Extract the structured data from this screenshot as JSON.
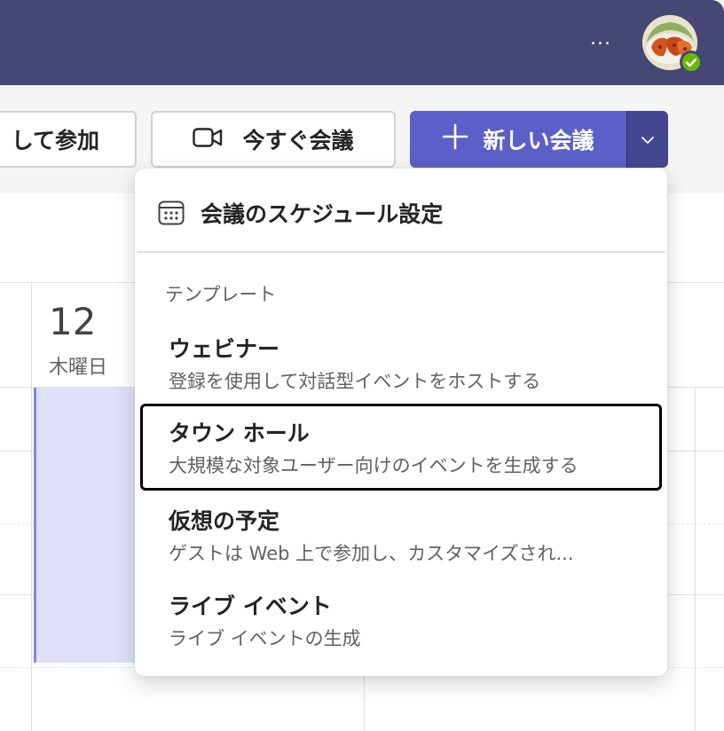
{
  "header": {
    "more_label": "...",
    "avatar_name": "user-avatar"
  },
  "toolbar": {
    "join_label": "して参加",
    "meet_now_label": "今すぐ会議",
    "new_meeting_label": "新しい会議"
  },
  "calendar": {
    "day_number": "12",
    "day_name": "木曜日"
  },
  "menu": {
    "schedule_label": "会議のスケジュール設定",
    "section_label": "テンプレート",
    "items": [
      {
        "title": "ウェビナー",
        "desc": "登録を使用して対話型イベントをホストする"
      },
      {
        "title": "タウン ホール",
        "desc": "大規模な対象ユーザー向けのイベントを生成する"
      },
      {
        "title": "仮想の予定",
        "desc": "ゲストは Web 上で参加し、カスタマイズされ..."
      },
      {
        "title": "ライブ イベント",
        "desc": "ライブ イベントの生成"
      }
    ]
  },
  "colors": {
    "titlebar": "#464775",
    "accent": "#5b5fc7",
    "accent_dark": "#444791",
    "event_fill": "#dfe0fa",
    "presence_available": "#6bb700"
  },
  "icons": {
    "more": "more-horizontal-icon",
    "camera": "video-camera-icon",
    "plus": "plus-icon",
    "chevron": "chevron-down-icon",
    "calendar": "calendar-icon",
    "presence": "presence-available-icon"
  }
}
